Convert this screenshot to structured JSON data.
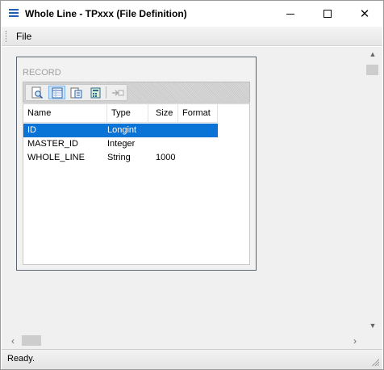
{
  "window": {
    "title": "Whole Line - TPxxx (File Definition)",
    "icons": {
      "app": "app-menu-icon",
      "minimize": "minimize-icon",
      "maximize": "maximize-icon",
      "close": "close-icon"
    },
    "close_glyph": "✕"
  },
  "menu": {
    "file_label": "File"
  },
  "record": {
    "title": "RECORD",
    "toolbar_icons": [
      "zoom-page-icon",
      "grid-view-icon",
      "form-view-icon",
      "calculator-icon",
      "insert-field-icon"
    ],
    "columns": {
      "name": "Name",
      "type": "Type",
      "size": "Size",
      "format": "Format"
    },
    "rows": [
      {
        "name": "ID",
        "type": "Longint",
        "size": "",
        "format": "",
        "selected": true
      },
      {
        "name": "MASTER_ID",
        "type": "Integer",
        "size": "",
        "format": "",
        "selected": false
      },
      {
        "name": "WHOLE_LINE",
        "type": "String",
        "size": "1000",
        "format": "",
        "selected": false
      }
    ]
  },
  "scroll": {
    "up": "▲",
    "down": "▼",
    "left": "‹",
    "right": "›"
  },
  "status": {
    "text": "Ready."
  },
  "colors": {
    "selection": "#0a74d6",
    "accent": "#1f5fae"
  }
}
